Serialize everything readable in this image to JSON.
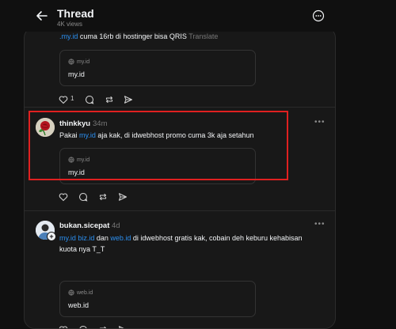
{
  "header": {
    "title": "Thread",
    "views": "4K views"
  },
  "posts": [
    {
      "body_link": ".my.id",
      "body_text": " cuma 16rb di hostinger bisa QRIS ",
      "translate": "Translate",
      "card": {
        "domain": "my.id",
        "title": "my.id"
      },
      "likes": "1"
    },
    {
      "username": "thinkkyu",
      "time": "34m",
      "body_pre": "Pakai ",
      "body_link": "my.id",
      "body_post": " aja kak, di idwebhost promo cuma 3k aja setahun",
      "card": {
        "domain": "my.id",
        "title": "my.id"
      }
    },
    {
      "username": "bukan.sicepat",
      "time": "4d",
      "links": [
        "my.id",
        "biz.id",
        "web.id"
      ],
      "body_dan": " dan ",
      "body_post": " di idwebhost gratis kak, cobain deh keburu kehabisan",
      "body_line2": "kuota nya T_T",
      "card": {
        "domain": "web.id",
        "title": "web.id"
      }
    }
  ],
  "colors": {
    "background": "#101010",
    "panel": "#181818",
    "link": "#2b8ff0",
    "highlight": "#e02020"
  },
  "icons": [
    "back-arrow-icon",
    "more-circle-icon",
    "heart-icon",
    "comment-icon",
    "repost-icon",
    "share-icon",
    "globe-icon"
  ]
}
